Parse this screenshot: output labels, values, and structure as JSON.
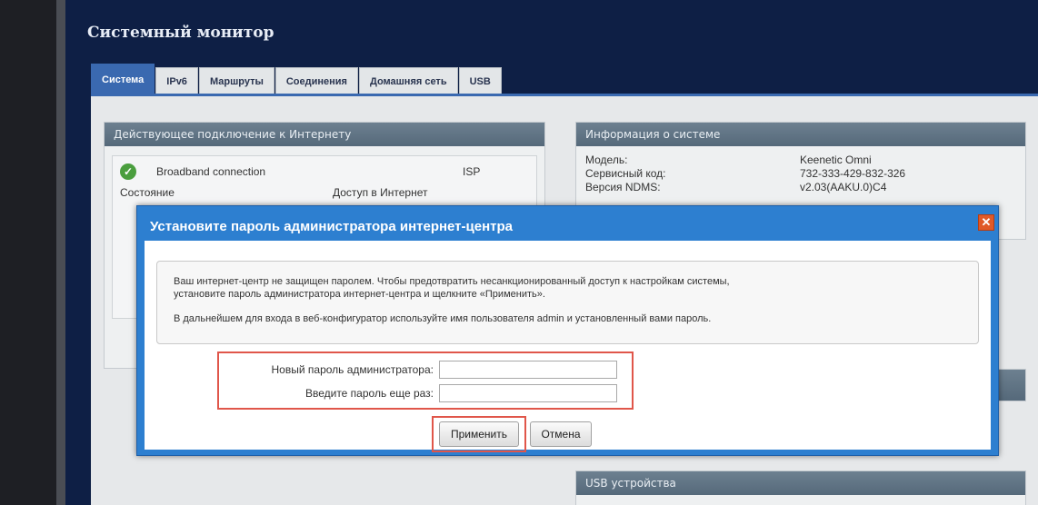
{
  "app": {
    "title": "Системный монитор"
  },
  "tabs": [
    {
      "label": "Система",
      "active": true
    },
    {
      "label": "IPv6"
    },
    {
      "label": "Маршруты"
    },
    {
      "label": "Соединения"
    },
    {
      "label": "Домашняя сеть"
    },
    {
      "label": "USB"
    }
  ],
  "internet_panel": {
    "title": "Действующее подключение к Интернету",
    "connection_name": "Broadband connection",
    "connection_type": "ISP",
    "state_label": "Состояние",
    "state_value": "Доступ в Интернет"
  },
  "sysinfo_panel": {
    "title": "Информация о системе",
    "rows": [
      {
        "key": "Модель:",
        "value": "Keenetic Omni"
      },
      {
        "key": "Сервисный код:",
        "value": "732-333-429-832-326"
      },
      {
        "key": "Версия NDMS:",
        "value": "v2.03(AAKU.0)C4"
      }
    ]
  },
  "usb_panel": {
    "title": "USB устройства"
  },
  "dialog": {
    "title": "Установите пароль администратора интернет-центра",
    "message_line1": "Ваш интернет-центр не защищен паролем. Чтобы предотвратить несанкционированный доступ к настройкам системы,",
    "message_line2": "установите пароль администратора интернет-центра и щелкните «Применить».",
    "message_line3": "В дальнейшем для входа в веб-конфигуратор используйте имя пользователя admin и установленный вами пароль.",
    "new_password_label": "Новый пароль администратора:",
    "new_password_value": "",
    "repeat_password_label": "Введите пароль еще раз:",
    "repeat_password_value": "",
    "apply_label": "Применить",
    "cancel_label": "Отмена",
    "close_glyph": "✕"
  },
  "colors": {
    "accent": "#3a69b0",
    "dialog": "#2d7fd0",
    "highlight": "#e0564a",
    "background": "#0e1f45"
  }
}
